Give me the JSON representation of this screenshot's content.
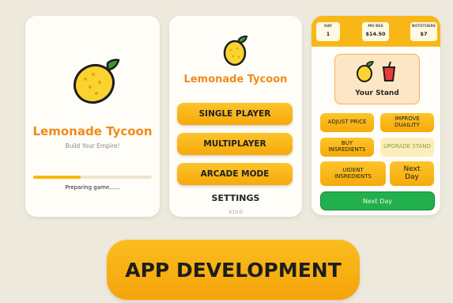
{
  "loading_screen": {
    "title": "Lemonade Tycoon",
    "subtitle": "Build Your Empire!",
    "progress": 0.4,
    "status": "Preparing game......"
  },
  "main_menu": {
    "title": "Lemonade Tycoon",
    "buttons": [
      "SINGLE PLAYER",
      "MULTIPLAYER",
      "ARCADE MODE"
    ],
    "settings": "SETTINGS",
    "version": "V10.0"
  },
  "game_screen": {
    "stats": [
      {
        "label": "DAY",
        "value": "1"
      },
      {
        "label": "MO BES",
        "value": "$14.50"
      },
      {
        "label": "BOTSTUERS",
        "value": "$7"
      }
    ],
    "stand_label": "Your Stand",
    "actions": {
      "adjust_price": "ADJUST PRICE",
      "improve_quality_line1": "IMPROVE",
      "improve_quality_line2": "DUAILITY",
      "buy_ingredients_line1": "BUY",
      "buy_ingredients_line2": "INSREDIENTS",
      "upgrade_stand": "UPGRADE STAND",
      "ingredients_line1": "UIDENT",
      "ingredients_line2": "INSREDIENTS",
      "next_day_small_line1": "Next",
      "next_day_small_line2": "Day"
    },
    "next_day": "Next Day"
  },
  "banner": {
    "text": "APP DEVELOPMENT"
  },
  "colors": {
    "accent_orange": "#f08a1a",
    "button_yellow": "#f9b514",
    "next_day_green": "#22b04d",
    "background": "#ede9dd"
  },
  "icons": [
    "lemon-icon",
    "lemonade-cup-icon"
  ]
}
